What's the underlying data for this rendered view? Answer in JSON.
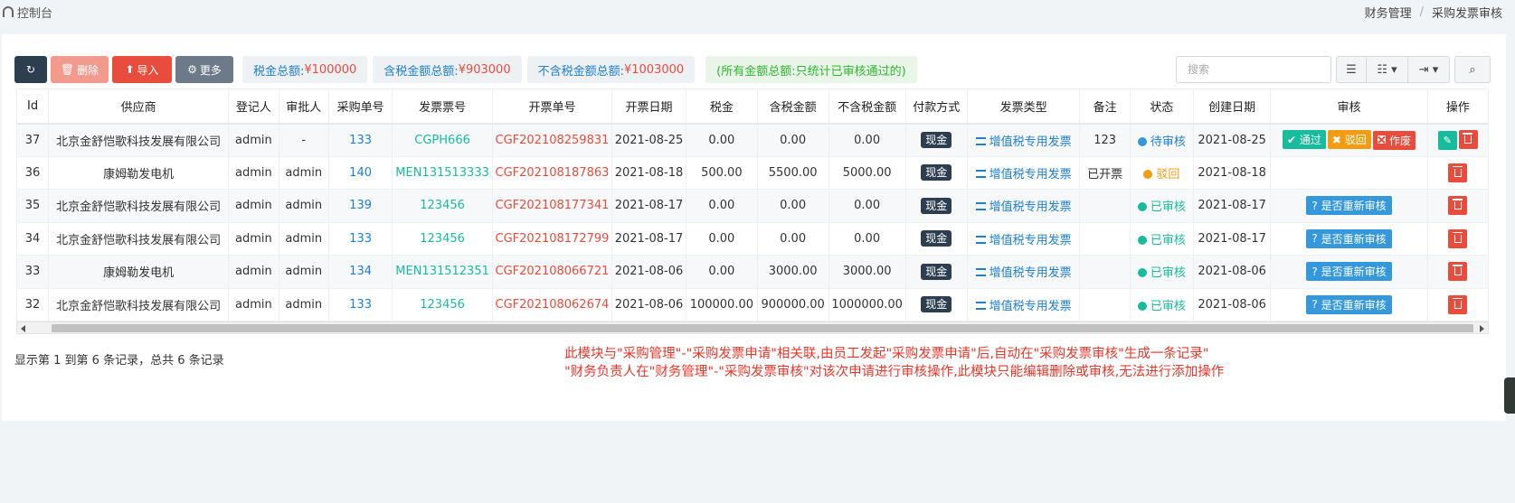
{
  "topbar": {
    "dashboard_label": "控制台",
    "breadcrumb": [
      "财务管理",
      "采购发票审核"
    ]
  },
  "toolbar": {
    "delete_label": "删除",
    "import_label": "导入",
    "more_label": "更多"
  },
  "stats": {
    "tax_label": "税金总额: ",
    "tax_value": "¥100000",
    "incl_label": "含税金额总额: ",
    "incl_value": "¥903000",
    "excl_label": "不含税金额总额: ",
    "excl_value": "¥1003000",
    "note": "(所有金额总额:只统计已审核通过的)"
  },
  "search": {
    "placeholder": "搜索"
  },
  "table": {
    "headers": [
      "Id",
      "供应商",
      "登记人",
      "审批人",
      "采购单号",
      "发票票号",
      "开票单号",
      "开票日期",
      "税金",
      "含税金额",
      "不含税金额",
      "付款方式",
      "发票类型",
      "备注",
      "状态",
      "创建日期",
      "审核",
      "操作"
    ],
    "rows": [
      {
        "id": "37",
        "supplier": "北京金舒恺歌科技发展有限公司",
        "registrar": "admin",
        "approver": "-",
        "po": "133",
        "invoice_no": "CGPH666",
        "bill_no": "CGF202108259831",
        "date": "2021-08-25",
        "tax": "0.00",
        "incl": "0.00",
        "excl": "0.00",
        "pay": "现金",
        "type": "增值税专用发票",
        "remark": "123",
        "status": "待审核",
        "created": "2021-08-25"
      },
      {
        "id": "36",
        "supplier": "康姆勒发电机",
        "registrar": "admin",
        "approver": "admin",
        "po": "140",
        "invoice_no": "MEN131513333",
        "bill_no": "CGF202108187863",
        "date": "2021-08-18",
        "tax": "500.00",
        "incl": "5500.00",
        "excl": "5000.00",
        "pay": "现金",
        "type": "增值税专用发票",
        "remark": "已开票",
        "status": "驳回",
        "created": "2021-08-18"
      },
      {
        "id": "35",
        "supplier": "北京金舒恺歌科技发展有限公司",
        "registrar": "admin",
        "approver": "admin",
        "po": "139",
        "invoice_no": "123456",
        "bill_no": "CGF202108177341",
        "date": "2021-08-17",
        "tax": "0.00",
        "incl": "0.00",
        "excl": "0.00",
        "pay": "现金",
        "type": "增值税专用发票",
        "remark": "",
        "status": "已审核",
        "created": "2021-08-17"
      },
      {
        "id": "34",
        "supplier": "北京金舒恺歌科技发展有限公司",
        "registrar": "admin",
        "approver": "admin",
        "po": "133",
        "invoice_no": "123456",
        "bill_no": "CGF202108172799",
        "date": "2021-08-17",
        "tax": "0.00",
        "incl": "0.00",
        "excl": "0.00",
        "pay": "现金",
        "type": "增值税专用发票",
        "remark": "",
        "status": "已审核",
        "created": "2021-08-17"
      },
      {
        "id": "33",
        "supplier": "康姆勒发电机",
        "registrar": "admin",
        "approver": "admin",
        "po": "134",
        "invoice_no": "MEN131512351",
        "bill_no": "CGF202108066721",
        "date": "2021-08-06",
        "tax": "0.00",
        "incl": "3000.00",
        "excl": "3000.00",
        "pay": "现金",
        "type": "增值税专用发票",
        "remark": "",
        "status": "已审核",
        "created": "2021-08-06"
      },
      {
        "id": "32",
        "supplier": "北京金舒恺歌科技发展有限公司",
        "registrar": "admin",
        "approver": "admin",
        "po": "133",
        "invoice_no": "123456",
        "bill_no": "CGF202108062674",
        "date": "2021-08-06",
        "tax": "100000.00",
        "incl": "900000.00",
        "excl": "1000000.00",
        "pay": "现金",
        "type": "增值税专用发票",
        "remark": "",
        "status": "已审核",
        "created": "2021-08-06"
      }
    ],
    "audit_labels": {
      "pass": "通过",
      "reject": "驳回",
      "void": "作废",
      "reaudit": "是否重新审核"
    }
  },
  "footer": {
    "page_info": "显示第 1 到第 6 条记录，总共 6 条记录",
    "note_line1": "此模块与\"采购管理\"-\"采购发票申请\"相关联,由员工发起\"采购发票申请\"后,自动在\"采购发票审核\"生成一条记录\"",
    "note_line2": "\"财务负责人在\"财务管理\"-\"采购发票审核\"对该次申请进行审核操作,此模块只能编辑删除或审核,无法进行添加操作"
  }
}
